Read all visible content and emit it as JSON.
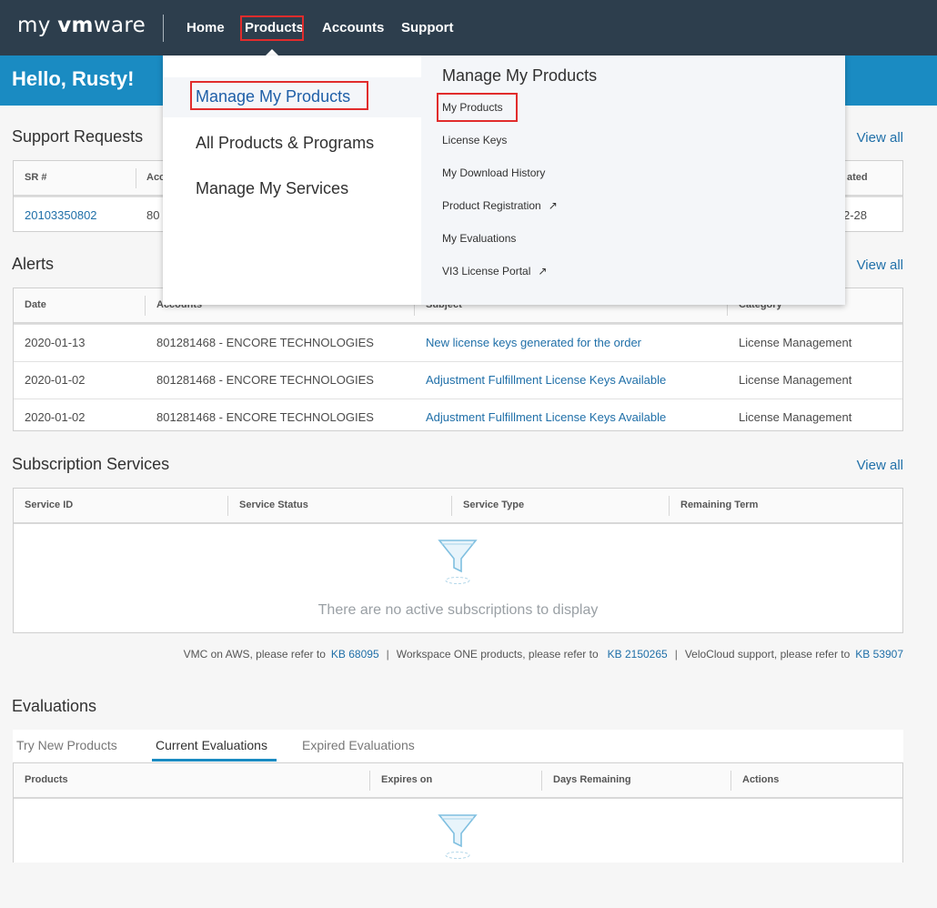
{
  "header": {
    "logo_my": "my",
    "logo_brand": "vm",
    "logo_ware": "ware",
    "nav": [
      "Home",
      "Products",
      "Accounts",
      "Support"
    ]
  },
  "greeting": "Hello, Rusty!",
  "support": {
    "title": "Support Requests",
    "view_all": "View all",
    "columns": [
      "SR #",
      "Acc",
      "ated"
    ],
    "row": {
      "sr": "20103350802",
      "acc": "80",
      "date": "2-28"
    }
  },
  "alerts": {
    "title": "Alerts",
    "view_all": "View all",
    "columns": [
      "Date",
      "Accounts",
      "Subject",
      "Category"
    ],
    "rows": [
      {
        "date": "2020-01-13",
        "account": "801281468 - ENCORE TECHNOLOGIES",
        "subject": "New license keys generated for the order",
        "category": "License Management"
      },
      {
        "date": "2020-01-02",
        "account": "801281468 - ENCORE TECHNOLOGIES",
        "subject": "Adjustment Fulfillment License Keys Available",
        "category": "License Management"
      },
      {
        "date": "2020-01-02",
        "account": "801281468 - ENCORE TECHNOLOGIES",
        "subject": "Adjustment Fulfillment License Keys Available",
        "category": "License Management"
      }
    ]
  },
  "subscriptions": {
    "title": "Subscription Services",
    "view_all": "View all",
    "columns": [
      "Service ID",
      "Service Status",
      "Service Type",
      "Remaining Term"
    ],
    "empty_text": "There are no active subscriptions to display",
    "refs": [
      {
        "text": "VMC on AWS, please refer to",
        "kb": "KB 68095"
      },
      {
        "text": "Workspace ONE products, please refer to",
        "kb": "KB 2150265"
      },
      {
        "text": "VeloCloud support, please refer to",
        "kb": "KB 53907"
      }
    ]
  },
  "evaluations": {
    "title": "Evaluations",
    "tabs": [
      "Try New Products",
      "Current Evaluations",
      "Expired Evaluations"
    ],
    "active_tab": "Current Evaluations",
    "columns": [
      "Products",
      "Expires on",
      "Days Remaining",
      "Actions"
    ]
  },
  "dropdown": {
    "left": [
      "Manage My Products",
      "All Products & Programs",
      "Manage My Services"
    ],
    "selected": "Manage My Products",
    "heading": "Manage My Products",
    "links": [
      "My Products",
      "License Keys",
      "My Download History",
      "Product Registration",
      "My Evaluations",
      "VI3 License Portal"
    ],
    "external_icon": "↗"
  },
  "colors": {
    "topbar": "#2d3e4d",
    "banner": "#1a8bc2",
    "link": "#1f6fa8",
    "highlight": "#e12c2c"
  }
}
